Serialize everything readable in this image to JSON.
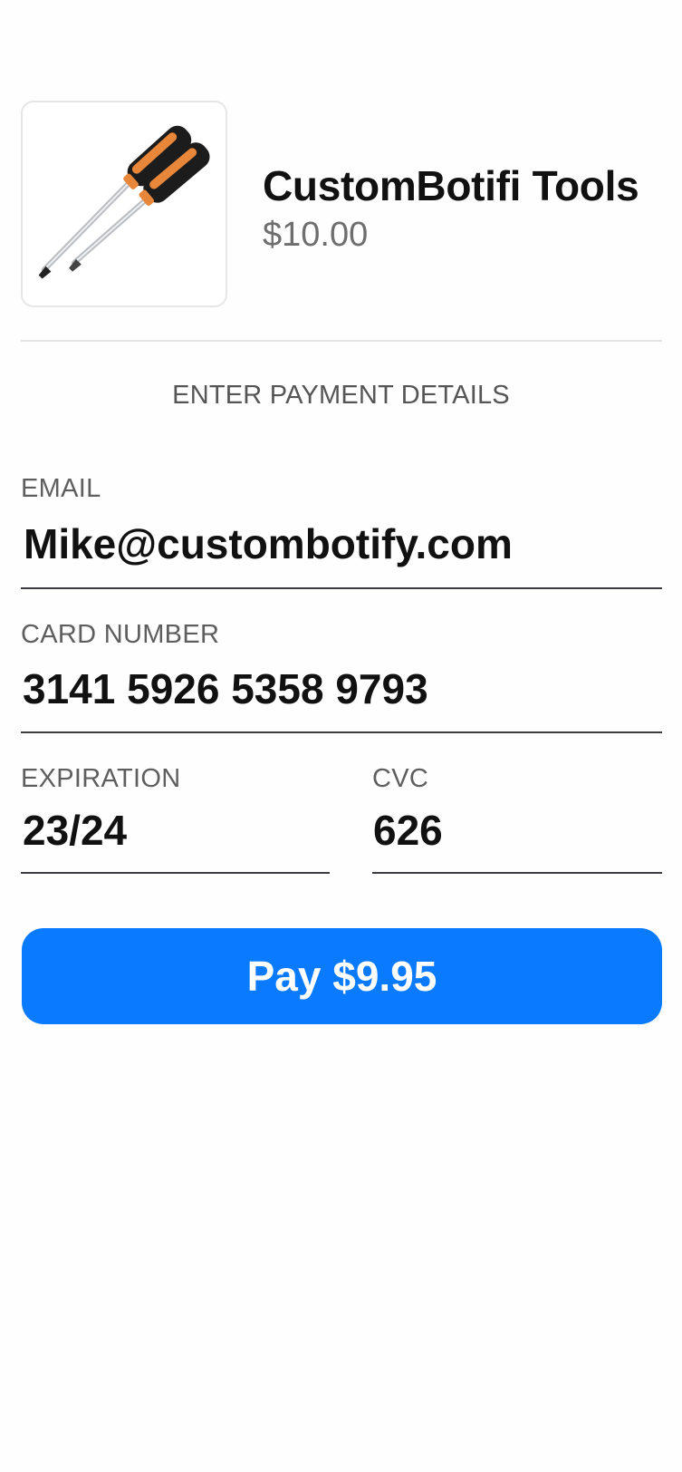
{
  "product": {
    "name": "CustomBotifi Tools",
    "price": "$10.00",
    "image_icon": "screwdriver-set-icon"
  },
  "payment": {
    "section_title": "ENTER PAYMENT DETAILS",
    "email": {
      "label": "EMAIL",
      "value": "Mike@custombotify.com"
    },
    "card_number": {
      "label": "CARD NUMBER",
      "value": "3141 5926 5358 9793"
    },
    "expiration": {
      "label": "EXPIRATION",
      "value": "23/24"
    },
    "cvc": {
      "label": "CVC",
      "value": "626"
    }
  },
  "pay_button": {
    "label": "Pay $9.95"
  },
  "colors": {
    "accent": "#0a7aff",
    "price_text": "#6e6e6e",
    "handle_orange": "#e8873a"
  }
}
